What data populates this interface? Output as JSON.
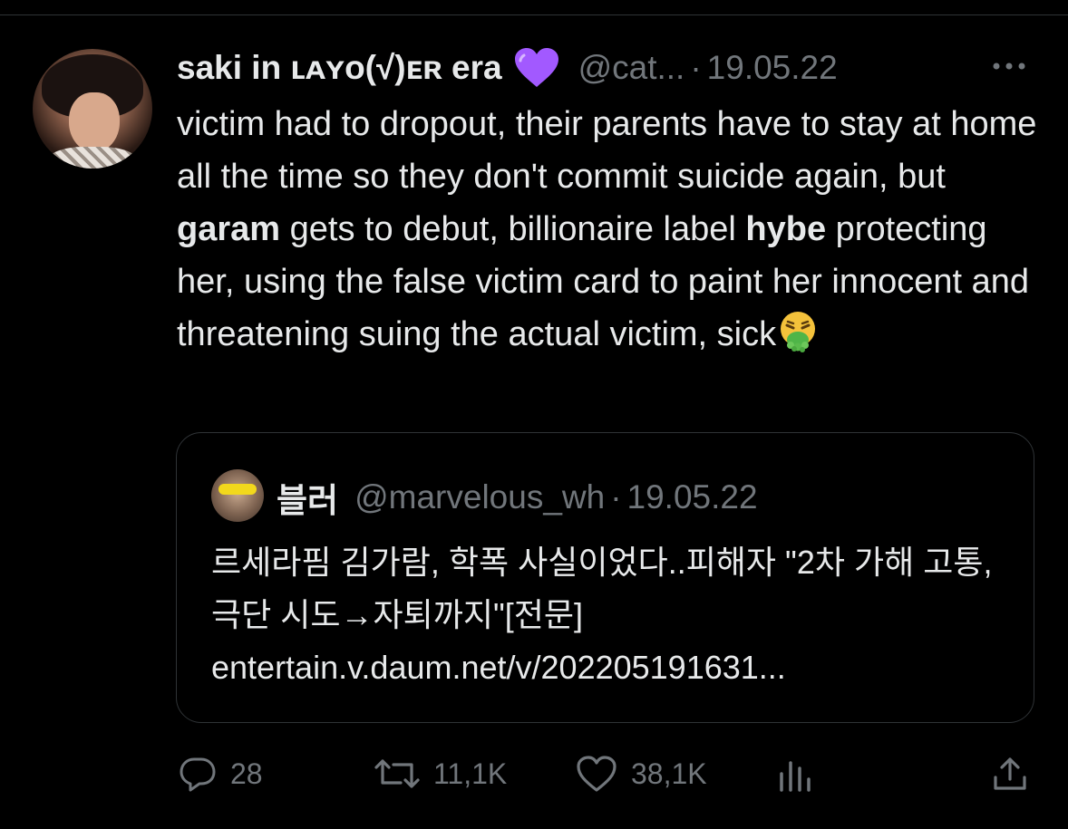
{
  "tweet": {
    "display_name": "saki in ʟᴀʏᴏ(√)ᴇʀ era",
    "handle": "@cat...",
    "separator": "·",
    "date": "19.05.22",
    "text_parts": [
      "victim had to dropout, their parents have to stay at home all the time so they don't commit suicide again, but ",
      "garam",
      " gets to debut, billionaire label ",
      "hybe",
      " protecting her, using the false victim card to paint her innocent and threatening suing the actual victim, sick"
    ]
  },
  "quote": {
    "display_name": "블러",
    "handle": "@marvelous_wh",
    "separator": "·",
    "date": "19.05.22",
    "text": "르세라핌 김가람, 학폭 사실이었다..피해자 \"2차 가해 고통, 극단 시도→자퇴까지\"[전문] entertain.v.daum.net/v/202205191631..."
  },
  "actions": {
    "reply": {
      "icon": "reply-icon",
      "count": "28"
    },
    "retweet": {
      "icon": "retweet-icon",
      "count": "11,1K"
    },
    "like": {
      "icon": "heart-outline-icon",
      "count": "38,1K"
    },
    "views": {
      "icon": "views-bar-icon"
    },
    "share": {
      "icon": "share-icon"
    }
  },
  "colors": {
    "background": "#000000",
    "text_primary": "#e7e9ea",
    "text_secondary": "#71767b",
    "border": "#2f3336",
    "heart_emoji": "#a259ff"
  }
}
